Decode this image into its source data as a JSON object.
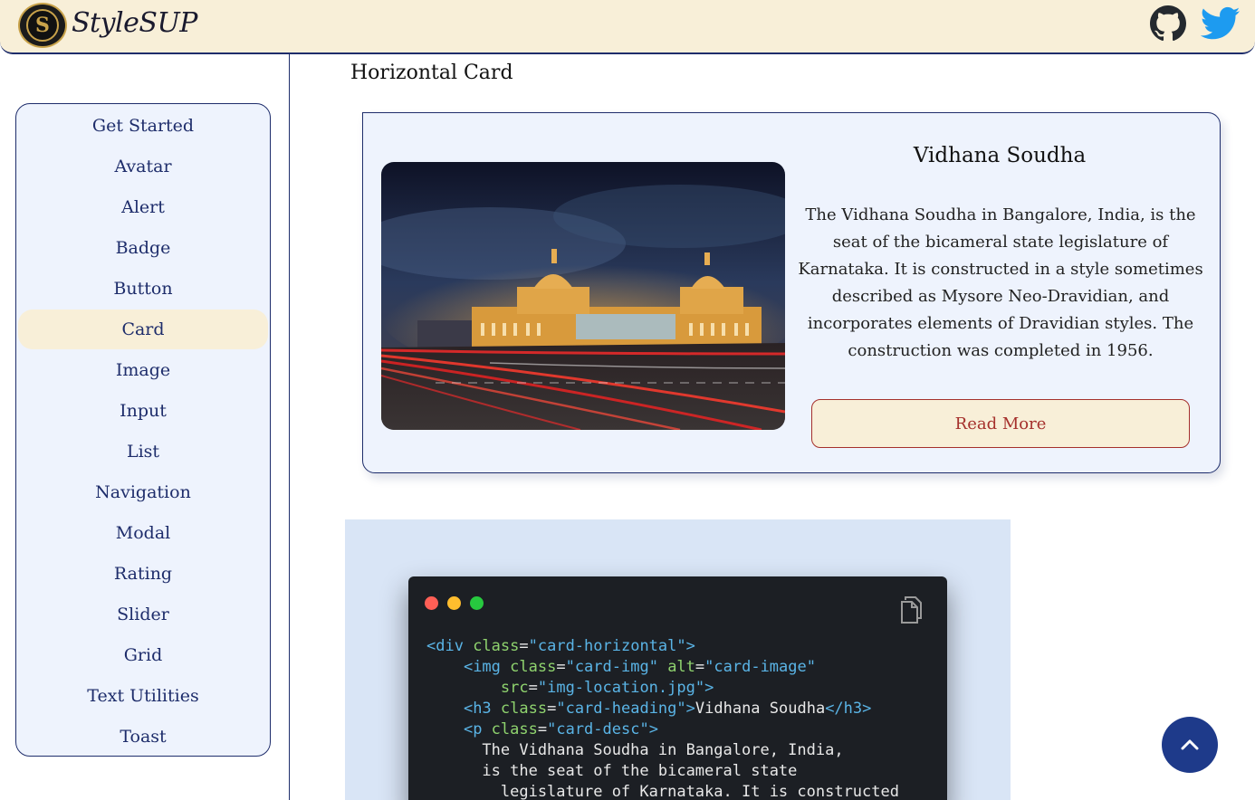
{
  "header": {
    "logo_letter": "S",
    "brand": "StyleSUP",
    "icons": [
      "github-icon",
      "twitter-icon"
    ]
  },
  "sidebar": {
    "items": [
      {
        "label": "Get Started"
      },
      {
        "label": "Avatar"
      },
      {
        "label": "Alert"
      },
      {
        "label": "Badge"
      },
      {
        "label": "Button"
      },
      {
        "label": "Card",
        "active": true
      },
      {
        "label": "Image"
      },
      {
        "label": "Input"
      },
      {
        "label": "List"
      },
      {
        "label": "Navigation"
      },
      {
        "label": "Modal"
      },
      {
        "label": "Rating"
      },
      {
        "label": "Slider"
      },
      {
        "label": "Grid"
      },
      {
        "label": "Text Utilities"
      },
      {
        "label": "Toast"
      }
    ]
  },
  "main": {
    "section_title": "Horizontal Card",
    "card": {
      "heading": "Vidhana Soudha",
      "description": "The Vidhana Soudha in Bangalore, India, is the seat of the bicameral state legislature of Karnataka. It is constructed in a style sometimes described as Mysore Neo-Dravidian, and incorporates elements of Dravidian styles. The construction was completed in 1956.",
      "button_label": "Read More"
    },
    "code": {
      "lines": [
        [
          {
            "t": "tag",
            "v": "<div "
          },
          {
            "t": "attr",
            "v": "class"
          },
          {
            "t": "txt",
            "v": "="
          },
          {
            "t": "str",
            "v": "\"card-horizontal\""
          },
          {
            "t": "tag",
            "v": ">"
          }
        ],
        [
          {
            "t": "txt",
            "v": "    "
          },
          {
            "t": "tag",
            "v": "<img "
          },
          {
            "t": "attr",
            "v": "class"
          },
          {
            "t": "txt",
            "v": "="
          },
          {
            "t": "str",
            "v": "\"card-img\""
          },
          {
            "t": "txt",
            "v": " "
          },
          {
            "t": "attr",
            "v": "alt"
          },
          {
            "t": "txt",
            "v": "="
          },
          {
            "t": "str",
            "v": "\"card-image\""
          }
        ],
        [
          {
            "t": "txt",
            "v": "        "
          },
          {
            "t": "attr",
            "v": "src"
          },
          {
            "t": "txt",
            "v": "="
          },
          {
            "t": "str",
            "v": "\"img-location.jpg\""
          },
          {
            "t": "tag",
            "v": ">"
          }
        ],
        [
          {
            "t": "txt",
            "v": "    "
          },
          {
            "t": "tag",
            "v": "<h3 "
          },
          {
            "t": "attr",
            "v": "class"
          },
          {
            "t": "txt",
            "v": "="
          },
          {
            "t": "str",
            "v": "\"card-heading\""
          },
          {
            "t": "tag",
            "v": ">"
          },
          {
            "t": "txt",
            "v": "Vidhana Soudha"
          },
          {
            "t": "tag",
            "v": "</h3>"
          }
        ],
        [
          {
            "t": "txt",
            "v": "    "
          },
          {
            "t": "tag",
            "v": "<p "
          },
          {
            "t": "attr",
            "v": "class"
          },
          {
            "t": "txt",
            "v": "="
          },
          {
            "t": "str",
            "v": "\"card-desc\""
          },
          {
            "t": "tag",
            "v": ">"
          }
        ],
        [
          {
            "t": "txt",
            "v": "      The Vidhana Soudha in Bangalore, India,"
          }
        ],
        [
          {
            "t": "txt",
            "v": "      is the seat of the bicameral state"
          }
        ],
        [
          {
            "t": "txt",
            "v": "        legislature of Karnataka. It is constructed"
          }
        ]
      ]
    }
  },
  "colors": {
    "header_bg": "#f8efd8",
    "primary": "#1e2d6b",
    "accent_red": "#a5302c",
    "sidebar_bg": "#eef3fd"
  }
}
